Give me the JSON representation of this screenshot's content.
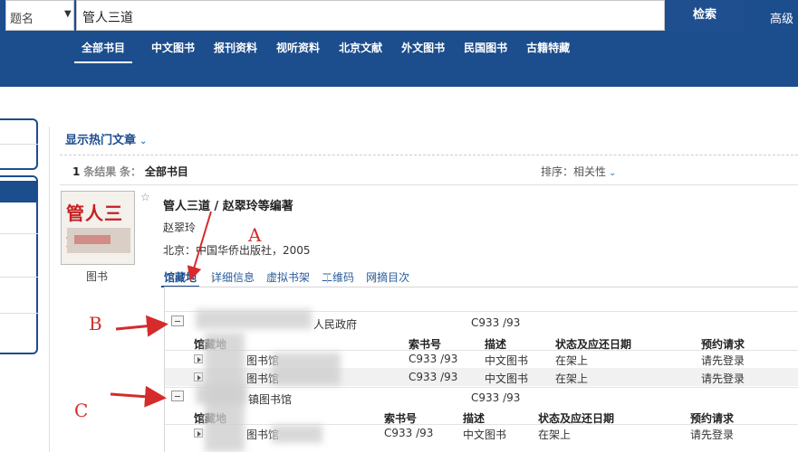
{
  "search": {
    "field_value": "题名",
    "query_value": "管人三道",
    "clear_label": "✕",
    "submit_label": "检索",
    "advanced_label": "高级"
  },
  "nav_tabs": [
    "全部书目",
    "中文图书",
    "报刊资料",
    "视听资料",
    "北京文献",
    "外文图书",
    "民国图书",
    "古籍特藏"
  ],
  "results": {
    "hot_articles_label": "显示热门文章",
    "count": "1",
    "count_suffix": "条结果",
    "scope_label": "条：",
    "scope_value": "全部书目",
    "sort_label": "排序：相关性"
  },
  "record": {
    "cover_title": "管人三道",
    "format": "图书",
    "title": "管人三道 / 赵翠玲等编著",
    "author": "赵翠玲",
    "publication": "北京：中国华侨出版社，2005",
    "tabs": [
      "馆藏地",
      "详细信息",
      "虚拟书架",
      "二维码",
      "网摘目次"
    ]
  },
  "holdings": {
    "columns": [
      "馆藏地",
      "索书号",
      "描述",
      "状态及应还日期",
      "预约请求"
    ],
    "groups": [
      {
        "library": "人民政府",
        "call_number": "C933 /93",
        "items": [
          {
            "location": "图书馆",
            "call_number": "C933 /93",
            "description": "中文图书",
            "status": "在架上",
            "request": "请先登录"
          },
          {
            "location": "图书馆",
            "call_number": "C933 /93",
            "description": "中文图书",
            "status": "在架上",
            "request": "请先登录"
          }
        ]
      },
      {
        "library": "镇图书馆",
        "call_number": "C933 /93",
        "items": [
          {
            "location": "图书馆",
            "call_number": "C933 /93",
            "description": "中文图书",
            "status": "在架上",
            "request": "请先登录"
          }
        ]
      }
    ]
  },
  "annotations": {
    "a": "A",
    "b": "B",
    "c": "C"
  },
  "colors": {
    "header_bg": "#1c4d8d",
    "annotation": "#d52b2b"
  }
}
